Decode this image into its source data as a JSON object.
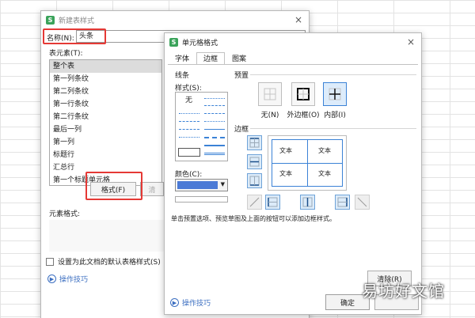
{
  "dialog1": {
    "title": "新建表样式",
    "name_label": "名称(N):",
    "name_value": "头条",
    "elements_label": "表元素(T):",
    "elements": [
      "整个表",
      "第一列条纹",
      "第二列条纹",
      "第一行条纹",
      "第二行条纹",
      "最后一列",
      "第一列",
      "标题行",
      "汇总行",
      "第一个标题单元格"
    ],
    "selected_element": "整个表",
    "format_button": "格式(F)",
    "clear_button": "清",
    "element_format_label": "元素格式:",
    "default_checkbox": "设置为此文档的默认表格样式(S)",
    "tips": "操作技巧",
    "close_glyph": "×"
  },
  "dialog2": {
    "title": "单元格格式",
    "tabs": [
      "字体",
      "边框",
      "图案"
    ],
    "active_tab": "边框",
    "line_group": "线条",
    "style_label": "样式(S):",
    "style_none": "无",
    "color_label": "颜色(C):",
    "line_color": "#4b7ad6",
    "preset_group": "预置",
    "presets": [
      "无(N)",
      "外边框(O)",
      "内部(I)"
    ],
    "border_group": "边框",
    "preview_cells": [
      "文本",
      "文本",
      "文本",
      "文本"
    ],
    "description": "单击预置选项、预览草图及上面的按钮可以添加边框样式。",
    "clear_button": "清除(R)",
    "tips": "操作技巧",
    "ok_button": "确定",
    "close_glyph": "×"
  },
  "watermark": "易坊好文馆",
  "colors": {
    "highlight_red": "#e53935",
    "accent_blue": "#3b82d6",
    "app_green": "#3aa35a"
  }
}
